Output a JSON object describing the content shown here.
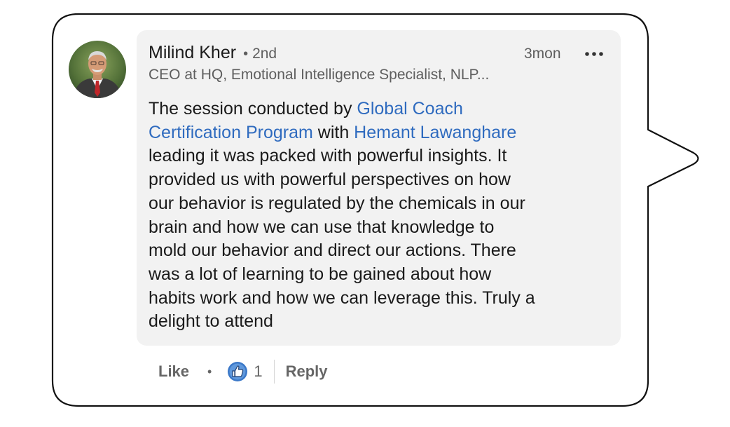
{
  "comment": {
    "author": {
      "name": "Milind Kher",
      "separator": "•",
      "degree": "2nd",
      "headline": "CEO at HQ, Emotional Intelligence Specialist, NLP..."
    },
    "timestamp": "3mon",
    "more_icon": "ellipsis-icon",
    "body": {
      "l1_text": "The session conducted by ",
      "l1_mention": "Global Coach",
      "l2_mention": "Certification Program",
      "l2_text": " with ",
      "l2_mention2": "Hemant Lawanghare",
      "l3": "leading it was packed with powerful insights. It",
      "l4": "provided us with powerful perspectives on how",
      "l5": "our behavior is regulated by the chemicals in our",
      "l6": "brain and how we can use that knowledge to",
      "l7": "mold our behavior and direct our actions. There",
      "l8": "was a lot of learning to be gained about how",
      "l9": "habits work and how we can leverage this. Truly a",
      "l10": "delight to attend"
    }
  },
  "actions": {
    "like_label": "Like",
    "separator": "•",
    "reaction_icon": "thumbs-up-icon",
    "reaction_count": "1",
    "reply_label": "Reply"
  },
  "colors": {
    "card_background": "#f2f2f2",
    "mention": "#2f6bbf",
    "muted_text": "#5e5e5e",
    "like_badge": "#3b78c8"
  }
}
